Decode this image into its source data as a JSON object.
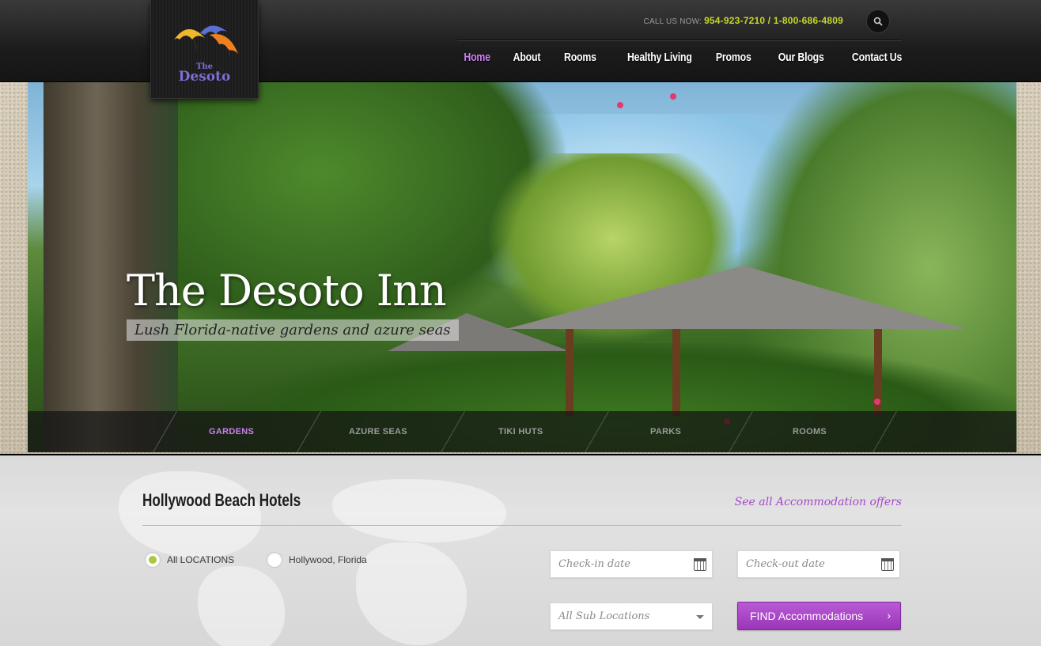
{
  "header": {
    "call_label": "CALL US NOW:",
    "phone": "954-923-7210 / 1-800-686-4809",
    "logo": {
      "the": "The",
      "name": "Desoto"
    },
    "nav": [
      {
        "label": "Home",
        "active": true
      },
      {
        "label": "About"
      },
      {
        "label": "Rooms"
      },
      {
        "label": "Healthy Living"
      },
      {
        "label": "Promos"
      },
      {
        "label": "Our Blogs"
      },
      {
        "label": "Contact Us"
      }
    ],
    "icons": [
      "search-icon"
    ]
  },
  "hero": {
    "title": "The Desoto Inn",
    "subtitle": "Lush Florida-native gardens and azure seas",
    "tabs": [
      {
        "label": "GARDENS",
        "active": true
      },
      {
        "label": "AZURE SEAS"
      },
      {
        "label": "TIKI HUTS"
      },
      {
        "label": "PARKS"
      },
      {
        "label": "ROOMS"
      }
    ]
  },
  "booking": {
    "title": "Hollywood Beach Hotels",
    "see_all": "See all Accommodation offers",
    "locations": [
      {
        "label": "All LOCATIONS",
        "selected": true
      },
      {
        "label": "Hollywood, Florida",
        "selected": false
      }
    ],
    "checkin_placeholder": "Check-in date",
    "checkout_placeholder": "Check-out date",
    "sublocation_value": "All Sub Locations",
    "find_label": "FIND Accommodations"
  },
  "colors": {
    "accent_purple": "#a548c9",
    "phone_green": "#c6d62a",
    "radio_green": "#a7c93a"
  }
}
